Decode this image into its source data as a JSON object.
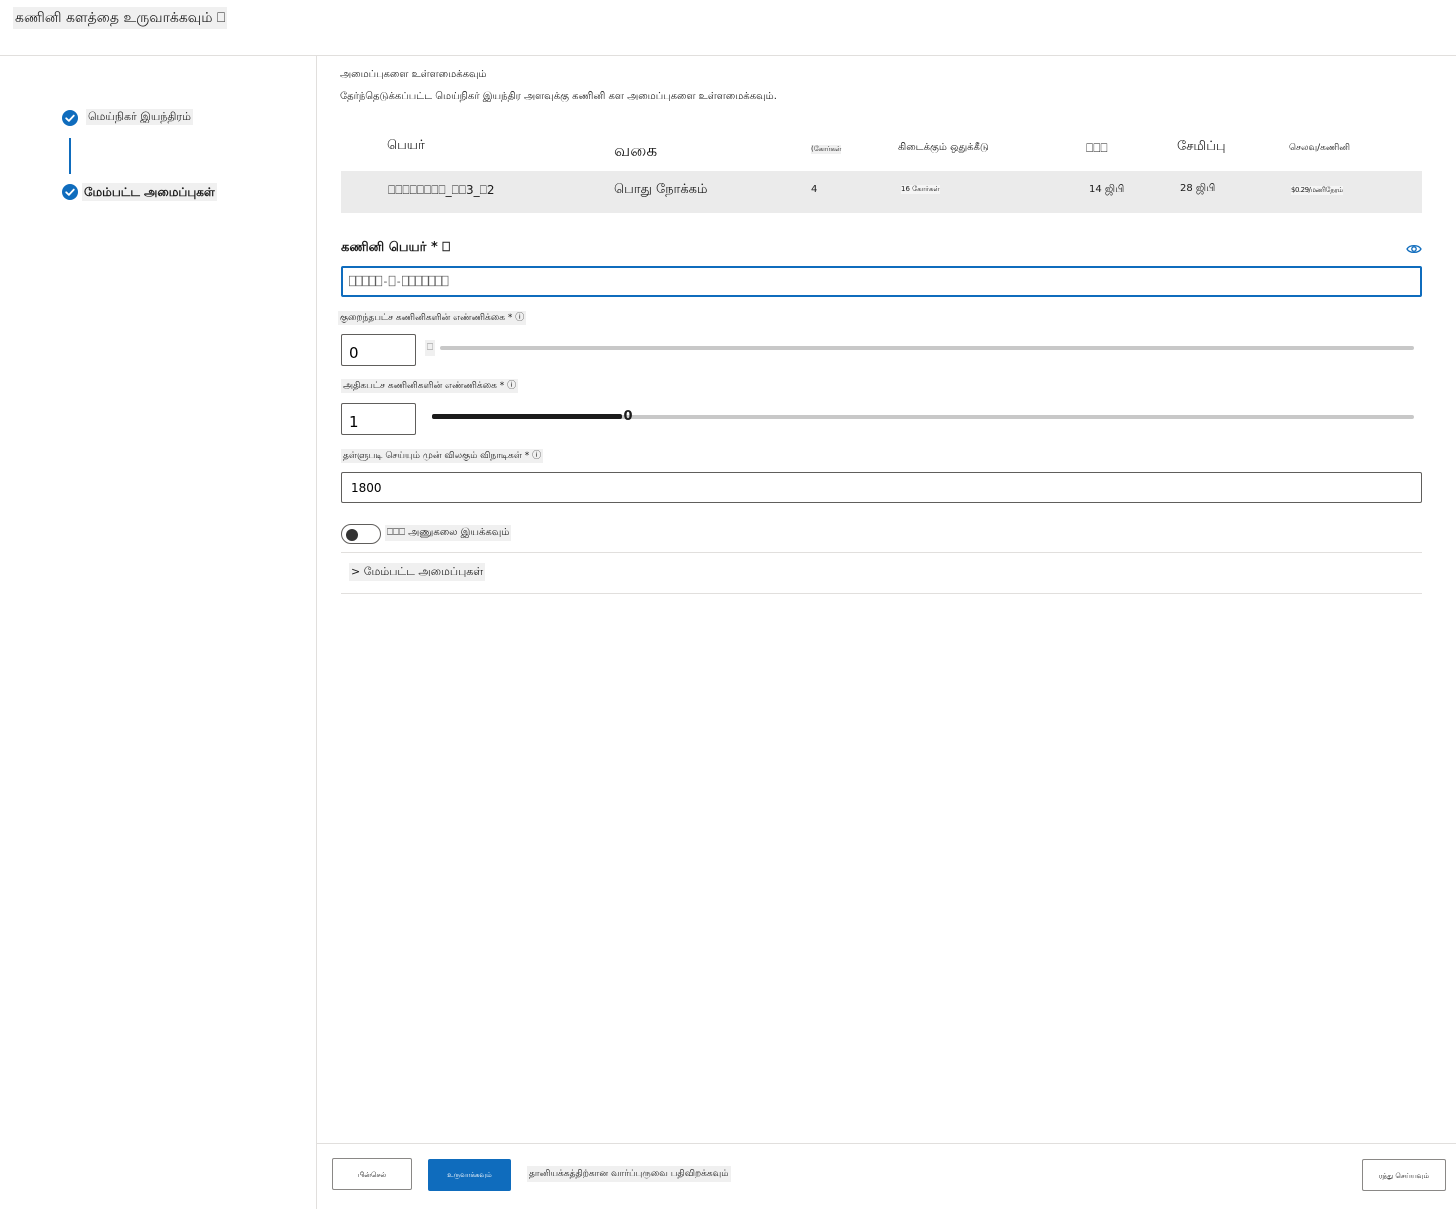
{
  "header": {
    "title": "கணினி களத்தை உருவாக்கவும் ⎕"
  },
  "steps": [
    {
      "label": "மெய்நிகர் இயந்திரம்",
      "status": "complete"
    },
    {
      "label": "மேம்பட்ட அமைப்புகள்",
      "status": "complete"
    }
  ],
  "main": {
    "heading": "அமைப்புகளை உள்ளமைக்கவும்",
    "description": "தேர்ந்தெடுக்கப்பட்ட மெய்நிகர் இயந்திர அளவுக்கு கணினி கள அமைப்புகளை உள்ளமைக்கவும்."
  },
  "vm_table": {
    "columns": [
      "பெயர்",
      "வகை",
      "(கோர்கள்",
      "கிடைக்கும் ஒதுக்கீடு",
      "⎕⎕⎕",
      "சேமிப்பு",
      "செலவு/கணினி"
    ],
    "row": [
      "⎕⎕⎕⎕⎕⎕⎕⎕_⎕⎕3_⎕2",
      "பொது நோக்கம்",
      "4",
      "16 கோர்கள்",
      "14 ஜிபி",
      "28 ஜிபி",
      "$0.29/மணிநேரம்"
    ]
  },
  "compute_name": {
    "label": "கணினி பெயர் * ⎕",
    "value": "⎕⎕⎕⎕⎕-⎕-⎕⎕⎕⎕⎕⎕⎕"
  },
  "min_nodes": {
    "label": "குறைந்தபட்ச கணினிகளின் எண்ணிக்கை * ⓘ",
    "value": "0",
    "thumb_glyph": "⎕",
    "level": 0
  },
  "max_nodes": {
    "label": "அதிகபட்ச கணினிகளின் எண்ணிக்கை * ⓘ",
    "value": "1",
    "thumb_glyph": "0",
    "level": 0.19
  },
  "idle_seconds": {
    "label": "தள்ளுபடி செய்யும் முன் விலகும் விநாடிகள் * ⓘ",
    "value": "1800"
  },
  "ssh": {
    "label": "⎕⎕⎕ அணுகலை இயக்கவும்",
    "enabled": false
  },
  "advanced": {
    "label": "> மேம்பட்ட அமைப்புகள்"
  },
  "footer": {
    "back_label": "பின்செல்",
    "create_label": "உருவாக்கவும்",
    "template_link": "தானியக்கத்திற்கான வார்ப்புருவை பதிவிறக்கவும்",
    "cancel_label": "ரத்து செய்யவும்"
  },
  "colors": {
    "accent": "#0f6cbd",
    "row_bg": "#ebebeb",
    "border": "#605e5c"
  },
  "icons": [
    "check-icon",
    "eye-icon"
  ]
}
